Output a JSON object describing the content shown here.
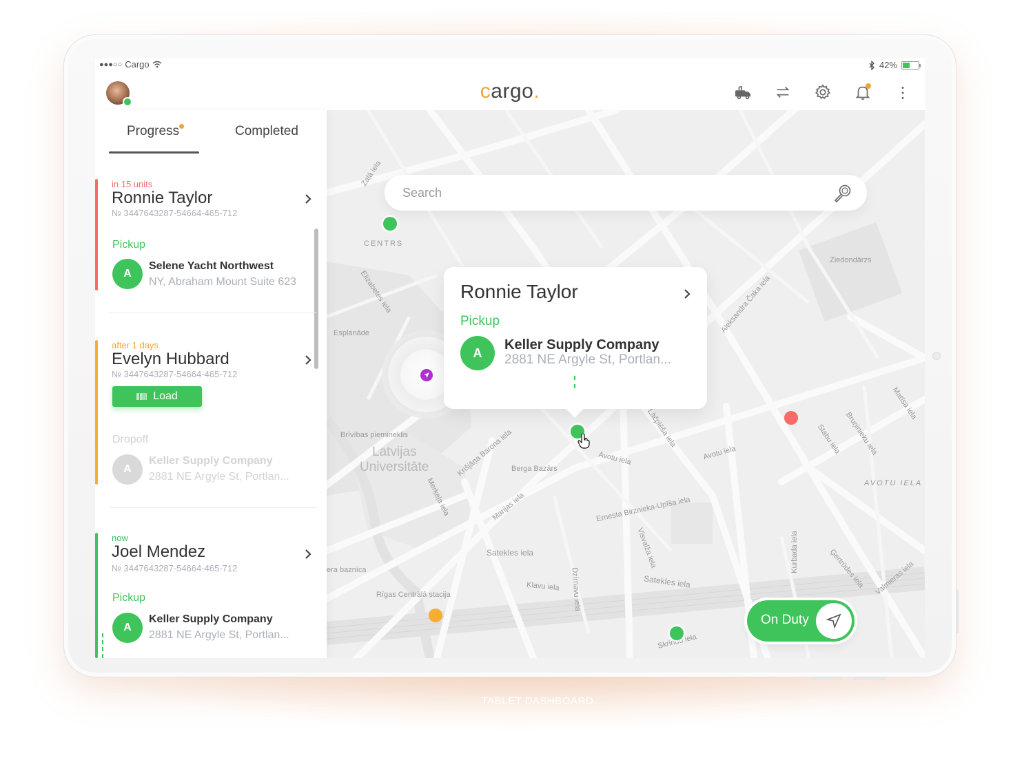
{
  "status_bar": {
    "carrier": "Cargo",
    "signal": "●●●○○",
    "battery": "42%"
  },
  "header": {
    "logo_c": "c",
    "logo_rest": "argo",
    "logo_dot": "."
  },
  "icons": {
    "avatar": "user-avatar",
    "truck": "truck-icon",
    "swap": "swap-arrows-icon",
    "settings": "gear-icon",
    "notifications": "bell-icon",
    "more": "kebab-menu-icon",
    "search": "search-icon",
    "navigate": "navigation-arrow-icon"
  },
  "tabs": {
    "progress": "Progress",
    "completed": "Completed"
  },
  "deliveries": [
    {
      "when": "in 15 units",
      "name": "Ronnie Taylor",
      "number": "№ 3447643287-54664-465-712",
      "stage": "Pickup",
      "avatar_letter": "A",
      "company": "Selene Yacht Northwest",
      "address": "NY, Abraham Mount Suite 623"
    },
    {
      "when": "after 1 days",
      "name": "Evelyn Hubbard",
      "number": "№ 3447643287-54664-465-712",
      "action": "Load",
      "stage": "Dropoff",
      "avatar_letter": "A",
      "company": "Keller Supply Company",
      "address": "2881 NE Argyle St, Portlan..."
    },
    {
      "when": "now",
      "name": "Joel Mendez",
      "number": "№ 3447643287-54664-465-712",
      "stage": "Pickup",
      "avatar_letter": "A",
      "company": "Keller Supply Company",
      "address": "2881 NE Argyle St, Portlan..."
    }
  ],
  "search": {
    "placeholder": "Search"
  },
  "popup": {
    "name": "Ronnie Taylor",
    "stage": "Pickup",
    "avatar_letter": "A",
    "company": "Keller Supply Company",
    "address": "2881 NE Argyle St, Portlan..."
  },
  "duty_toggle": {
    "label": "On Duty",
    "state": "on"
  },
  "map_labels": {
    "centrs": "CENTRS",
    "esplanade": "Esplanāde",
    "monument": "Brīvības piemineklis",
    "university_1": "Latvijas",
    "university_2": "Universitāte",
    "market": "Berga Bazārs",
    "ziedondarzs": "Ziedondārzs",
    "avotu": "AVOTU IELA",
    "station": "Rīgas Centrālā stacija",
    "church": "era baznīca",
    "satekles": "Satekles iela",
    "satekles2": "Satekles iela",
    "birznieka": "Ernesta Birznieka-Upīša iela",
    "klavu": "Ķlavu iela",
    "skrindu": "Skrindu iela",
    "marijas": "Marijas iela",
    "avotu_small": "Avotu iela",
    "avotu_small2": "Avotu iela",
    "lacplesa": "Lāčplēša iela",
    "stabu": "Stabu iela",
    "matisa": "Matīsa iela",
    "bruninieku": "Bruņinieku iela",
    "elizabetes": "Elizabetes iela",
    "zala": "Zaļā iela",
    "krisjana": "Krišjāņa Barona iela",
    "merkela": "Merķeļa iela",
    "gertrudes": "Ģertrūdes iela",
    "kurbada": "Kurbada iela",
    "valmieras": "Valmieras iela",
    "visvalza": "Visvalža iela",
    "dzirnavu": "Dzirnavu iela",
    "caka": "Aleksandra Čaka iela"
  },
  "caption": "TABLET DASHBOARD",
  "colors": {
    "accent_green": "#3ec45a",
    "accent_orange": "#f0a33a",
    "alert_red": "#f96a6a",
    "location_purple": "#b12fd1"
  }
}
